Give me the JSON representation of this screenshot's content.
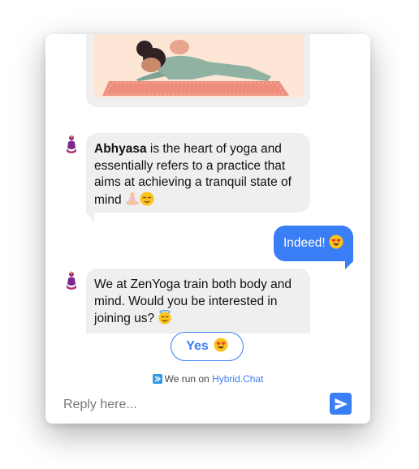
{
  "messages": {
    "m1": {
      "bold": "Abhyasa",
      "text": " is the heart of yoga and essentially refers to a practice that aims at achieving a tranquil state of mind"
    },
    "m2": {
      "text": "Indeed!"
    },
    "m3": {
      "text": "We at ZenYoga train both body and mind. Would you be interested in joining us?"
    }
  },
  "quick_reply": {
    "label": "Yes"
  },
  "footer": {
    "prefix": "We run on ",
    "link": "Hybrid.Chat"
  },
  "composer": {
    "placeholder": "Reply here..."
  },
  "icons": {
    "bot_avatar": "yoga-person-icon",
    "send": "send-icon",
    "brand": "hybrid-chat-logo-icon",
    "emoji_meditation": "person-in-lotus-position",
    "emoji_relieved": "relieved-face",
    "emoji_heart_eyes": "smiling-face-with-heart-eyes",
    "emoji_halo": "smiling-face-with-halo"
  },
  "colors": {
    "accent": "#3a7ef5",
    "incoming_bubble": "#efefef",
    "outgoing_text": "#ffffff"
  }
}
